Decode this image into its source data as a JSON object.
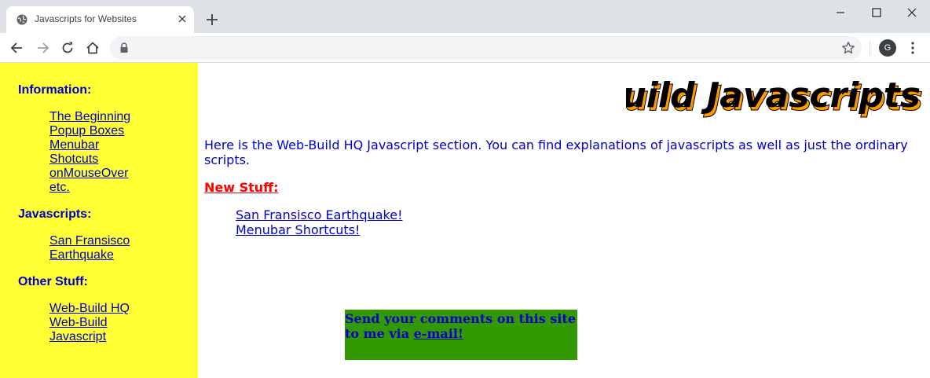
{
  "browser": {
    "tab_title": "Javascripts for Websites",
    "profile_initial": "G",
    "icons": [
      "globe-icon",
      "close-icon",
      "plus-icon",
      "minimize-icon",
      "maximize-icon",
      "close-window-icon",
      "back-icon",
      "forward-icon",
      "reload-icon",
      "home-icon",
      "lock-icon",
      "star-icon",
      "kebab-menu-icon"
    ]
  },
  "page": {
    "logo_text": "Web-Build Javascripts",
    "sidebar": {
      "background": "#ffff33",
      "sections": [
        {
          "heading": "Information:",
          "links": [
            "The Beginning",
            "Popup Boxes",
            "Menubar",
            "Shotcuts",
            "onMouseOver",
            "etc."
          ]
        },
        {
          "heading": "Javascripts:",
          "links": [
            "San Fransisco",
            "Earthquake"
          ]
        },
        {
          "heading": "Other Stuff:",
          "links": [
            "Web-Build HQ",
            "Web-Build",
            "Javascript"
          ]
        }
      ]
    },
    "intro": "Here is the Web-Build HQ Javascript section. You can find explanations of javascripts as well as just the ordinary scripts.",
    "new_stuff_heading": "New Stuff:",
    "new_stuff_links": [
      "San Fransisco Earthquake!",
      "Menubar Shortcuts!"
    ],
    "comments": {
      "text": "Send your comments on this site to me via ",
      "link": "e-mail!",
      "background": "#339900"
    }
  }
}
